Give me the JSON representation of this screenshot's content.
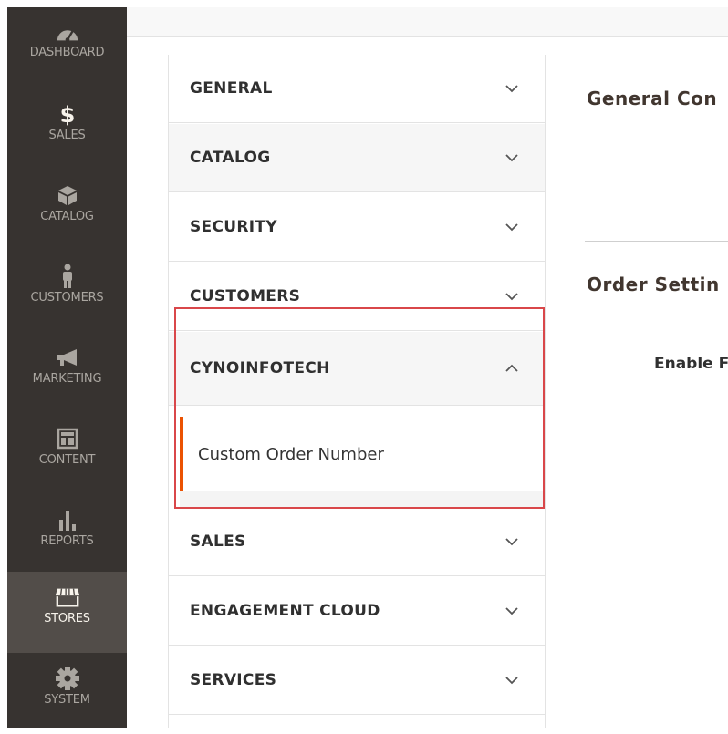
{
  "nav": {
    "items": [
      {
        "label": "DASHBOARD",
        "icon": "dashboard-icon"
      },
      {
        "label": "SALES",
        "icon": "dollar-icon"
      },
      {
        "label": "CATALOG",
        "icon": "box-icon"
      },
      {
        "label": "CUSTOMERS",
        "icon": "person-icon"
      },
      {
        "label": "MARKETING",
        "icon": "megaphone-icon"
      },
      {
        "label": "CONTENT",
        "icon": "layout-icon"
      },
      {
        "label": "REPORTS",
        "icon": "bar-chart-icon"
      },
      {
        "label": "STORES",
        "icon": "store-icon"
      },
      {
        "label": "SYSTEM",
        "icon": "gear-icon"
      }
    ],
    "active": "STORES"
  },
  "config_tabs": [
    {
      "label": "GENERAL",
      "expanded": false
    },
    {
      "label": "CATALOG",
      "expanded": false
    },
    {
      "label": "SECURITY",
      "expanded": false
    },
    {
      "label": "CUSTOMERS",
      "expanded": false
    },
    {
      "label": "CYNOINFOTECH",
      "expanded": true,
      "children": [
        "Custom Order Number"
      ]
    },
    {
      "label": "SALES",
      "expanded": false
    },
    {
      "label": "ENGAGEMENT CLOUD",
      "expanded": false
    },
    {
      "label": "SERVICES",
      "expanded": false
    }
  ],
  "content": {
    "section1_title": "General Con",
    "section2_title": "Order Settin",
    "field_label": "Enable F"
  },
  "colors": {
    "nav_bg": "#373330",
    "nav_active_bg": "#524d49",
    "accent": "#eb5202",
    "highlight_border": "#d9474a"
  }
}
